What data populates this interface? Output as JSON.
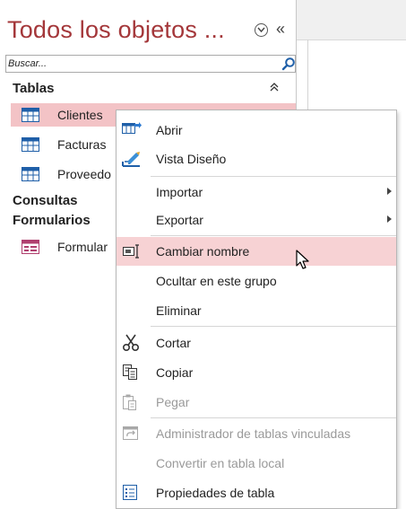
{
  "nav": {
    "title": "Todos los objetos ...",
    "dropdown_icon": "circle-chevron-down-icon",
    "collapse_label": "«",
    "search_placeholder": "Buscar...",
    "groups": {
      "tablas": "Tablas",
      "tablas_collapse": "⌃",
      "consultas": "Consultas",
      "formularios": "Formularios"
    },
    "items": [
      {
        "label": "Clientes",
        "icon": "table-icon"
      },
      {
        "label": "Facturas",
        "icon": "table-icon"
      },
      {
        "label": "Proveedo",
        "icon": "table-icon"
      },
      {
        "label": "Formular",
        "icon": "form-icon"
      }
    ]
  },
  "context_menu": {
    "items": [
      {
        "label": "Abrir",
        "icon": "open-table-icon"
      },
      {
        "label": "Vista Diseño",
        "icon": "design-view-icon"
      },
      {
        "label": "Importar"
      },
      {
        "label": "Exportar"
      },
      {
        "label": "Cambiar nombre",
        "icon": "rename-icon"
      },
      {
        "label": "Ocultar en este grupo"
      },
      {
        "label": "Eliminar"
      },
      {
        "label": "Cortar",
        "icon": "scissors-icon"
      },
      {
        "label": "Copiar",
        "icon": "copy-icon"
      },
      {
        "label": "Pegar",
        "icon": "paste-icon"
      },
      {
        "label": "Administrador de tablas vinculadas",
        "icon": "linked-table-manager-icon"
      },
      {
        "label": "Convertir en tabla local"
      },
      {
        "label": "Propiedades de tabla",
        "icon": "properties-icon"
      }
    ]
  },
  "colors": {
    "accent": "#a4373a",
    "selection": "#f3c3c6",
    "menu_highlight": "#f7d2d4"
  }
}
